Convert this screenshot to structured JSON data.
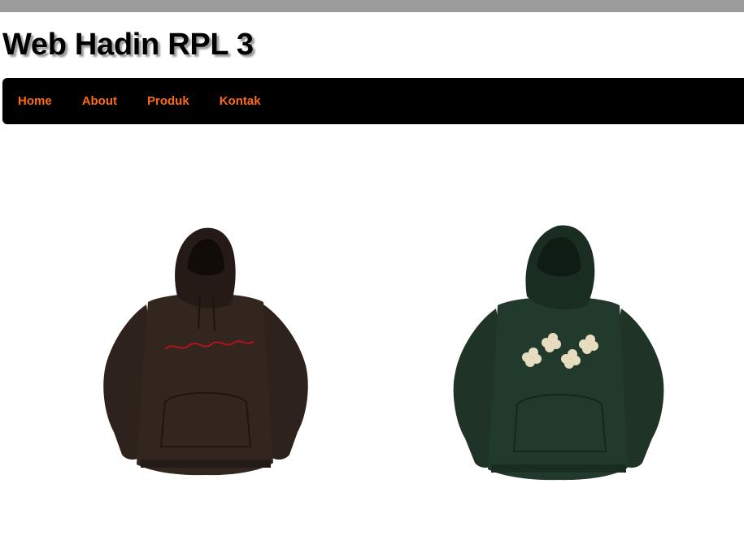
{
  "site": {
    "title": "Web Hadin RPL 3"
  },
  "nav": {
    "items": [
      {
        "label": "Home"
      },
      {
        "label": "About"
      },
      {
        "label": "Produk"
      },
      {
        "label": "Kontak"
      }
    ]
  },
  "colors": {
    "top_strip": "#9b9b9b",
    "nav_background": "#000000",
    "nav_link": "#ff6a14",
    "hoodie_brown": "#2e221c",
    "hoodie_green": "#1f3426",
    "embroidery_red": "#b0141a",
    "print_cream": "#e8dcc0"
  },
  "products": [
    {
      "image": "brown-hoodie-image"
    },
    {
      "image": "green-hoodie-image"
    }
  ]
}
